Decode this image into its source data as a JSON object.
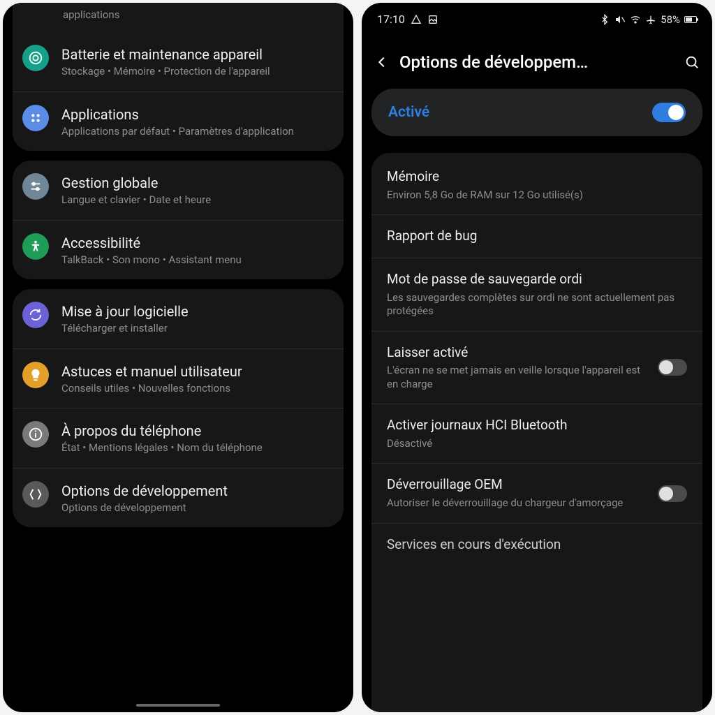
{
  "left": {
    "partial_top_sub": "applications",
    "groups": [
      {
        "rows": [
          {
            "icon": "device-care-icon",
            "color": "#16a089",
            "title": "Batterie et maintenance appareil",
            "sub": "Stockage  •  Mémoire  •  Protection de l'appareil"
          },
          {
            "icon": "apps-icon",
            "color": "#5b8de6",
            "title": "Applications",
            "sub": "Applications par défaut  •  Paramètres d'application"
          }
        ]
      },
      {
        "rows": [
          {
            "icon": "sliders-icon",
            "color": "#6f8796",
            "title": "Gestion globale",
            "sub": "Langue et clavier  •  Date et heure"
          },
          {
            "icon": "accessibility-icon",
            "color": "#1f9d58",
            "title": "Accessibilité",
            "sub": "TalkBack  •  Son mono  •  Assistant menu"
          }
        ]
      },
      {
        "rows": [
          {
            "icon": "update-icon",
            "color": "#6a62d6",
            "title": "Mise à jour logicielle",
            "sub": "Télécharger et installer"
          },
          {
            "icon": "tips-icon",
            "color": "#e2a02a",
            "title": "Astuces et manuel utilisateur",
            "sub": "Conseils utiles  •  Nouvelles fonctions"
          },
          {
            "icon": "info-icon",
            "color": "#7a7a7a",
            "title": "À propos du téléphone",
            "sub": "État  •  Mentions légales  •  Nom du téléphone"
          },
          {
            "icon": "dev-icon",
            "color": "#5a5a5a",
            "title": "Options de développement",
            "sub": "Options de développement"
          }
        ]
      }
    ]
  },
  "right": {
    "status": {
      "time": "17:10",
      "battery_pct": "58%",
      "battery_fill_pct": 58
    },
    "header": {
      "title": "Options de développem…"
    },
    "active": {
      "label": "Activé",
      "on": true
    },
    "items": [
      {
        "title": "Mémoire",
        "sub": "Environ 5,8 Go de RAM sur 12 Go utilisé(s)",
        "toggle": null
      },
      {
        "title": "Rapport de bug",
        "sub": "",
        "toggle": null
      },
      {
        "title": "Mot de passe de sauvegarde ordi",
        "sub": "Les sauvegardes complètes sur ordi ne sont actuellement pas protégées",
        "toggle": null
      },
      {
        "title": "Laisser activé",
        "sub": "L'écran ne se met jamais en veille lorsque l'appareil est en charge",
        "toggle": false
      },
      {
        "title": "Activer journaux HCI Bluetooth",
        "sub": "Désactivé",
        "toggle": null
      },
      {
        "title": "Déverrouillage OEM",
        "sub": "Autoriser le déverrouillage du chargeur d'amorçage",
        "toggle": false
      },
      {
        "title": "Services en cours d'exécution",
        "sub": "",
        "toggle": null,
        "cutoff": true
      }
    ]
  }
}
